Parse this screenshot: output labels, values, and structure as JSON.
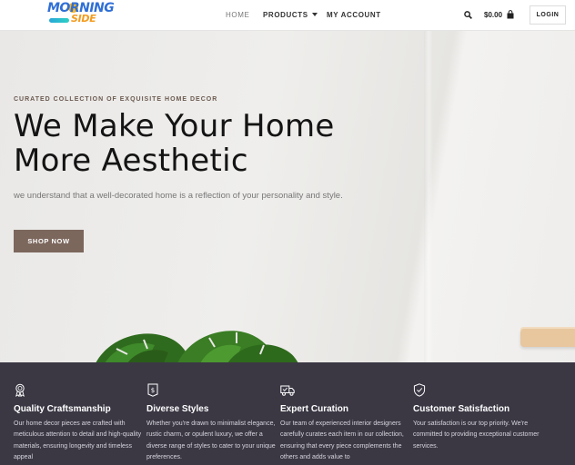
{
  "header": {
    "logo": {
      "line1": "MORNING",
      "line2": "SIDE"
    },
    "nav": [
      {
        "label": "HOME"
      },
      {
        "label": "PRODUCTS"
      },
      {
        "label": "MY ACCOUNT"
      }
    ],
    "cart_amount": "$0.00",
    "login_label": "LOGIN",
    "icons": {
      "search": "search-icon",
      "cart": "shopping-bag-icon",
      "products_dropdown": "caret-down-icon"
    }
  },
  "hero": {
    "eyebrow": "CURATED COLLECTION OF EXQUISITE HOME DECOR",
    "headline_line1": "We Make Your Home",
    "headline_line2": "More Aesthetic",
    "subtext": "we understand that a well-decorated home is a reflection of your personality and style.",
    "cta_label": "SHOP NOW",
    "colors": {
      "cta_bg": "#7c675d",
      "headline": "#141414"
    }
  },
  "features": [
    {
      "icon": "ribbon-award-icon",
      "title": "Quality Craftsmanship",
      "desc": "Our home decor pieces are crafted with meticulous attention to detail and high-quality materials, ensuring longevity and timeless appeal"
    },
    {
      "icon": "price-tag-icon",
      "title": "Diverse Styles",
      "desc": "Whether you're drawn to minimalist elegance, rustic charm, or opulent luxury, we offer a diverse range of styles to cater to your unique preferences."
    },
    {
      "icon": "delivery-truck-icon",
      "title": "Expert Curation",
      "desc": "Our team of experienced interior designers carefully curates each item in our collection, ensuring that every piece complements the others and adds value to"
    },
    {
      "icon": "shield-check-icon",
      "title": "Customer Satisfaction",
      "desc": "Your satisfaction is our top priority. We're committed to providing exceptional customer services."
    }
  ],
  "colors": {
    "features_bg": "#3b3844",
    "brand_blue": "#2f6fd6",
    "brand_orange": "#f39c1f"
  }
}
